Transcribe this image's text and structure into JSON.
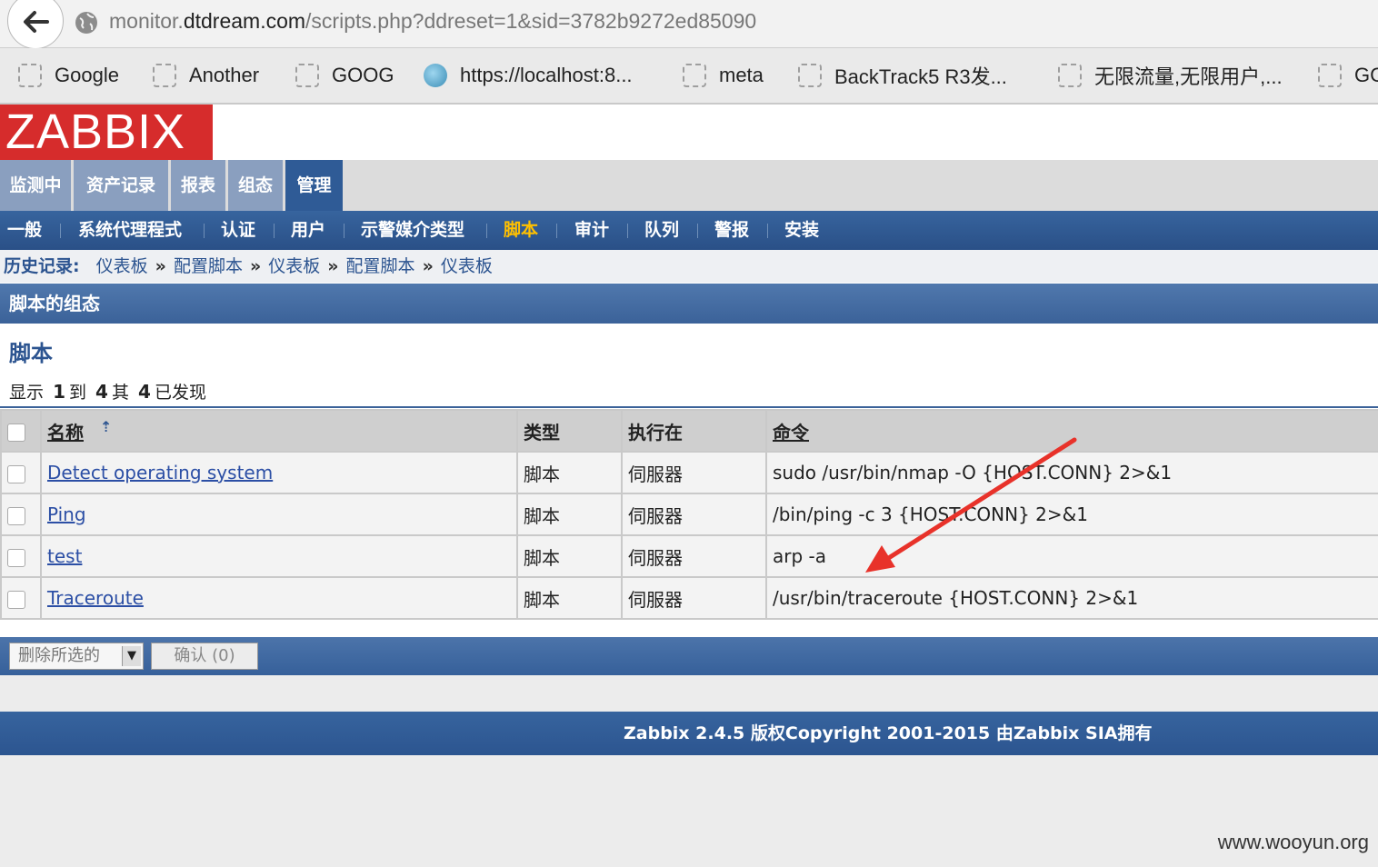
{
  "browser": {
    "url_prefix": "monitor.",
    "url_domain": "dtdream.com",
    "url_path": "/scripts.php?ddreset=1&sid=3782b9272ed85090",
    "bookmarks": [
      "Google",
      "Another",
      "GOOG",
      "https://localhost:8...",
      "meta",
      "BackTrack5 R3发...",
      "无限流量,无限用户,...",
      "GC"
    ]
  },
  "logo": "ZABBIX",
  "top_tabs": [
    "监测中",
    "资产记录",
    "报表",
    "组态",
    "管理"
  ],
  "sub_menu": [
    "一般",
    "系统代理程式",
    "认证",
    "用户",
    "示警媒介类型",
    "脚本",
    "审计",
    "队列",
    "警报",
    "安装"
  ],
  "history": {
    "label": "历史记录:",
    "items": [
      "仪表板",
      "配置脚本",
      "仪表板",
      "配置脚本",
      "仪表板"
    ],
    "arrow": "»"
  },
  "page_title": "脚本的组态",
  "section_title": "脚本",
  "found": {
    "pre": "显示",
    "from": "1",
    "to_word": "到",
    "to": "4",
    "of_word": "其",
    "total": "4",
    "post": "已发现"
  },
  "table": {
    "headers": [
      "名称",
      "类型",
      "执行在",
      "命令"
    ],
    "rows": [
      {
        "name": "Detect operating system",
        "type": "脚本",
        "exec": "伺服器",
        "command": "sudo /usr/bin/nmap -O {HOST.CONN} 2>&1"
      },
      {
        "name": "Ping",
        "type": "脚本",
        "exec": "伺服器",
        "command": "/bin/ping -c 3 {HOST.CONN} 2>&1"
      },
      {
        "name": "test",
        "type": "脚本",
        "exec": "伺服器",
        "command": "arp -a"
      },
      {
        "name": "Traceroute",
        "type": "脚本",
        "exec": "伺服器",
        "command": "/usr/bin/traceroute {HOST.CONN} 2>&1"
      }
    ]
  },
  "actions": {
    "select_label": "删除所选的",
    "confirm_label": "确认 (0)"
  },
  "footer": "Zabbix 2.4.5 版权Copyright 2001-2015 由Zabbix SIA拥有",
  "watermark": "www.wooyun.org",
  "colors": {
    "logo_bg": "#d62c2c",
    "nav_blue": "#2f5b96",
    "active_sub": "#ffc000",
    "annotation_arrow": "#e8322a"
  }
}
